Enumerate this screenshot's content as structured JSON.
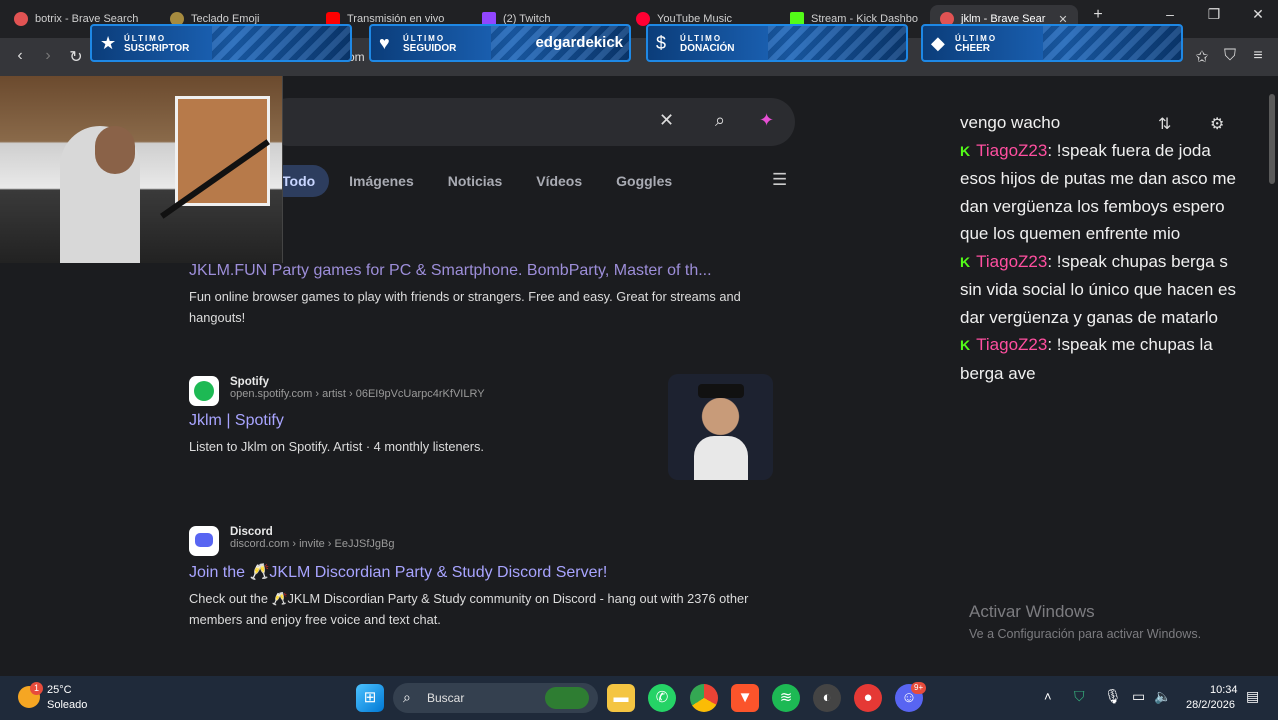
{
  "tabs": [
    {
      "title": "botrix - Brave Search",
      "color": "#e15353"
    },
    {
      "title": "Teclado Emoji",
      "color": "#a68b3f"
    },
    {
      "title": "Transmisión en vivo",
      "color": "#ff0000"
    },
    {
      "title": "(2) Twitch",
      "color": "#9146ff"
    },
    {
      "title": "YouTube Music",
      "color": "#ff0033"
    },
    {
      "title": "Stream - Kick Dashbo",
      "color": "#53fc18"
    },
    {
      "title": "jklm - Brave Sear",
      "color": "#e15353"
    }
  ],
  "overlays": [
    {
      "line1": "ÚLTIMO",
      "line2": "SUSCRIPTOR",
      "value": "",
      "icon": "star-icon"
    },
    {
      "line1": "ÚLTIMO",
      "line2": "SEGUIDOR",
      "value": "edgardekick",
      "icon": "heart-icon"
    },
    {
      "line1": "ÚLTIMO",
      "line2": "DONACIÓN",
      "value": "",
      "icon": "dollar-icon"
    },
    {
      "line1": "ÚLTIMO",
      "line2": "CHEER",
      "value": "",
      "icon": "diamond-icon"
    }
  ],
  "address_fragment": "om",
  "search": {
    "placeholder": ""
  },
  "nav_tabs": [
    "Todo",
    "Imágenes",
    "Noticias",
    "Vídeos",
    "Goggles"
  ],
  "results": [
    {
      "title": "JKLM.FUN Party games for PC & Smartphone. BombParty, Master of th...",
      "desc": "Fun online browser games to play with friends or strangers. Free and easy. Great for streams and hangouts!"
    },
    {
      "site": "Spotify",
      "url": "open.spotify.com › artist › 06EI9pVcUarpc4rKfVILRY",
      "title": "Jklm | Spotify",
      "desc": "Listen to Jklm on Spotify. Artist · 4 monthly listeners."
    },
    {
      "site": "Discord",
      "url": "discord.com › invite › EeJJSfJgBg",
      "title": "Join the 🥂JKLM Discordian Party & Study Discord Server!",
      "desc": "Check out the 🥂JKLM Discordian Party & Study community on Discord - hang out with 2376 other members and enjoy free voice and text chat."
    }
  ],
  "chat": {
    "first_line": "vengo wacho",
    "messages": [
      {
        "user": "TiagoZ23",
        "text": "!speak fuera de joda esos hijos de putas me dan asco me dan vergüenza los femboys espero que los quemen enfrente mio"
      },
      {
        "user": "TiagoZ23",
        "text": "!speak chupas berga s sin vida social lo único que hacen es dar vergüenza y ganas de matarlo"
      },
      {
        "user": "TiagoZ23",
        "text": "!speak me chupas la berga ave"
      }
    ]
  },
  "activate_windows": {
    "title": "Activar Windows",
    "subtitle": "Ve a Configuración para activar Windows."
  },
  "taskbar": {
    "weather_temp": "25°C",
    "weather_desc": "Soleado",
    "weather_badge": "1",
    "search_label": "Buscar",
    "time": "10:34",
    "date": "28/2/2026",
    "discord_badge": "9+"
  }
}
